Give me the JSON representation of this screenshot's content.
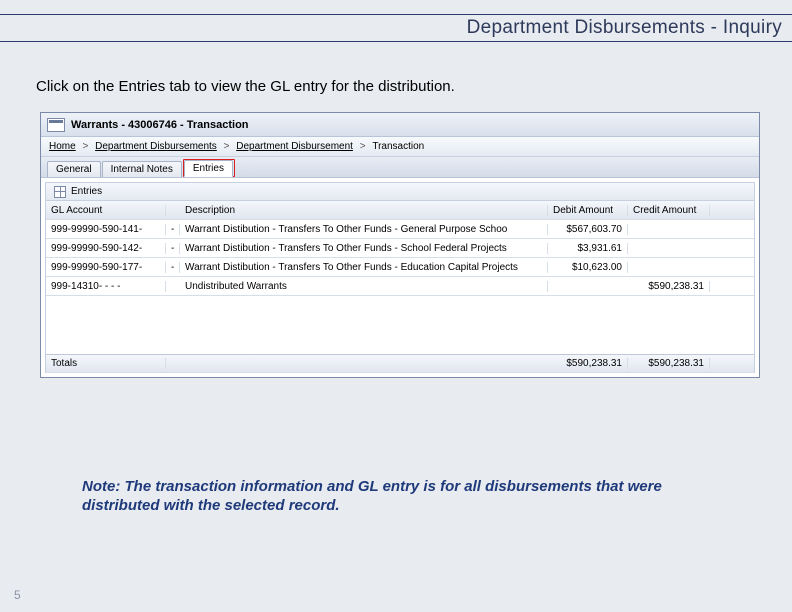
{
  "header": {
    "title": "Department Disbursements - Inquiry"
  },
  "instruction": "Click on the Entries tab to view the GL entry for the distribution.",
  "window": {
    "title": "Warrants - 43006746 - Transaction",
    "breadcrumb": {
      "home": "Home",
      "l1": "Department Disbursements",
      "l2": "Department Disbursement",
      "l3": "Transaction"
    },
    "tabs": {
      "general": "General",
      "notes": "Internal Notes",
      "entries": "Entries"
    },
    "panel_title": "Entries",
    "columns": {
      "gl": "GL Account",
      "desc": "Description",
      "debit": "Debit Amount",
      "credit": "Credit Amount"
    },
    "rows": [
      {
        "gl": "999-99990-590-141-",
        "dash": "-",
        "desc": "Warrant Distibution - Transfers To Other Funds - General Purpose Schoo",
        "debit": "$567,603.70",
        "credit": ""
      },
      {
        "gl": "999-99990-590-142-",
        "dash": "-",
        "desc": "Warrant Distibution - Transfers To Other Funds - School Federal Projects",
        "debit": "$3,931.61",
        "credit": ""
      },
      {
        "gl": "999-99990-590-177-",
        "dash": "-",
        "desc": "Warrant Distibution - Transfers To Other Funds - Education Capital Projects",
        "debit": "$10,623.00",
        "credit": ""
      },
      {
        "gl": "999-14310- - - -",
        "dash": "",
        "desc": "Undistributed Warrants",
        "debit": "",
        "credit": "$590,238.31"
      }
    ],
    "totals": {
      "label": "Totals",
      "debit": "$590,238.31",
      "credit": "$590,238.31"
    }
  },
  "note": "Note: The transaction information and GL entry is for all disbursements that were distributed with the selected record.",
  "page_number": "5"
}
